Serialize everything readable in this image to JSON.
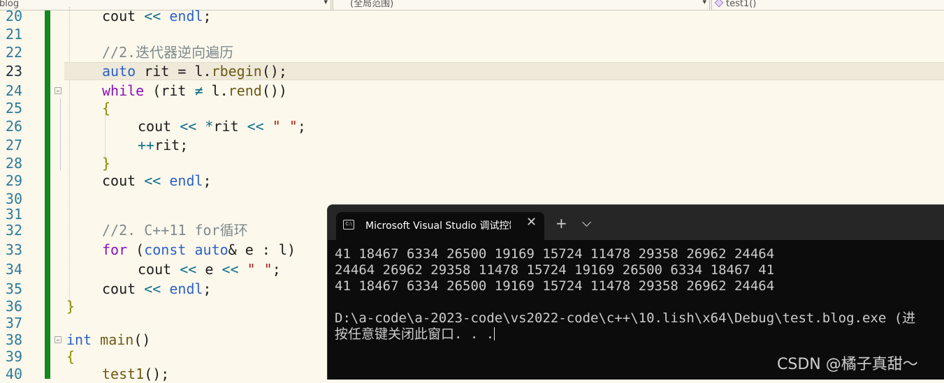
{
  "navbar": {
    "project": "blog",
    "scope": "(全局范围)",
    "function": "test1()"
  },
  "editor": {
    "lines": [
      {
        "num": "20",
        "code": "cout << endl;"
      },
      {
        "num": "21",
        "code": ""
      },
      {
        "num": "22",
        "code": "//2.迭代器逆向遍历"
      },
      {
        "num": "23",
        "code": "auto rit = l.rbegin();"
      },
      {
        "num": "24",
        "code": "while (rit ≠ l.rend())"
      },
      {
        "num": "25",
        "code": "{"
      },
      {
        "num": "26",
        "code": "cout << *rit << \" \";"
      },
      {
        "num": "27",
        "code": "++rit;"
      },
      {
        "num": "28",
        "code": "}"
      },
      {
        "num": "29",
        "code": "cout << endl;"
      },
      {
        "num": "30",
        "code": ""
      },
      {
        "num": "31",
        "code": ""
      },
      {
        "num": "32",
        "code": "//2. C++11 for循环"
      },
      {
        "num": "33",
        "code": "for (const auto& e : l)"
      },
      {
        "num": "34",
        "code": "cout << e << \" \";"
      },
      {
        "num": "35",
        "code": "cout << endl;"
      },
      {
        "num": "36",
        "code": "}"
      },
      {
        "num": "37",
        "code": ""
      },
      {
        "num": "38",
        "code": "int main()"
      },
      {
        "num": "39",
        "code": "{"
      },
      {
        "num": "40",
        "code": "test1();"
      }
    ],
    "current_line": "23",
    "colors": {
      "keyword": "#8a10c0",
      "string": "#a8201a",
      "comment": "#7d8a8e",
      "change_bar": "#0f8a1e"
    }
  },
  "console": {
    "tab_title": "Microsoft Visual Studio 调试控制台",
    "output": [
      "41 18467 6334 26500 19169 15724 11478 29358 26962 24464",
      "24464 26962 29358 11478 15724 19169 26500 6334 18467 41",
      "41 18467 6334 26500 19169 15724 11478 29358 26962 24464",
      "",
      "D:\\a-code\\a-2023-code\\vs2022-code\\c++\\10.lish\\x64\\Debug\\test.blog.exe (进",
      "按任意键关闭此窗口. . ."
    ]
  },
  "watermark": "CSDN @橘子真甜～"
}
